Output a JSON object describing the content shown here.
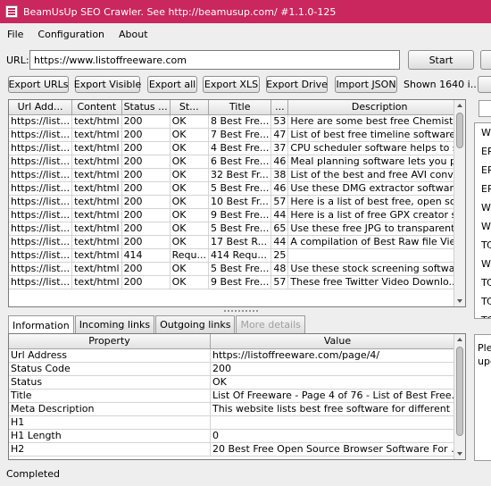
{
  "window": {
    "title": "BeamUsUp SEO Crawler. See http://beamusup.com/ #1.1.0-125"
  },
  "menu": {
    "items": [
      "File",
      "Configuration",
      "About"
    ]
  },
  "url_bar": {
    "label": "URL:",
    "value": "https://www.listoffreeware.com",
    "start_label": "Start"
  },
  "exports": {
    "buttons": [
      "Export URLs",
      "Export Visible",
      "Export all",
      "Export XLS",
      "Export Drive",
      "Import JSON"
    ],
    "shown_text": "Shown 1640 i..."
  },
  "url_table": {
    "columns": [
      "Url Add...",
      "Content",
      "Status ...",
      "St...",
      "Title",
      "...",
      "Description"
    ],
    "rows": [
      [
        "https://list...",
        "text/html",
        "200",
        "OK",
        "8 Best Fre...",
        "53",
        "Here are some best free Chemistr..."
      ],
      [
        "https://list...",
        "text/html",
        "200",
        "OK",
        "7 Best Fre...",
        "47",
        "List of best free timeline software ..."
      ],
      [
        "https://list...",
        "text/html",
        "200",
        "OK",
        "4 Best Fre...",
        "37",
        "CPU scheduler software helps to s..."
      ],
      [
        "https://list...",
        "text/html",
        "200",
        "OK",
        "6 Best Fre...",
        "46",
        "Meal planning software lets you pl..."
      ],
      [
        "https://list...",
        "text/html",
        "200",
        "OK",
        "32 Best Fr...",
        "38",
        "List of the best and free AVI conv..."
      ],
      [
        "https://list...",
        "text/html",
        "200",
        "OK",
        "5 Best Fre...",
        "46",
        "Use these DMG extractor software..."
      ],
      [
        "https://list...",
        "text/html",
        "200",
        "OK",
        "10 Best Fr...",
        "57",
        "Here is a list of best free, open so..."
      ],
      [
        "https://list...",
        "text/html",
        "200",
        "OK",
        "9 Best Fre...",
        "44",
        "Here is a list of free GPX creator s..."
      ],
      [
        "https://list...",
        "text/html",
        "200",
        "OK",
        "5 Best Fre...",
        "65",
        "Use these free JPG to transparent..."
      ],
      [
        "https://list...",
        "text/html",
        "200",
        "OK",
        "17 Best R...",
        "44",
        "A compilation of Best Raw file Vie..."
      ],
      [
        "https://list...",
        "text/html",
        "414",
        "Requ...",
        "414 Requ...",
        "25",
        ""
      ],
      [
        "https://list...",
        "text/html",
        "200",
        "OK",
        "5 Best Fre...",
        "48",
        "Use these stock screening softwar..."
      ],
      [
        "https://list...",
        "text/html",
        "200",
        "OK",
        "9 Best Fre...",
        "57",
        "These free Twitter Video Downlo..."
      ]
    ]
  },
  "detail_tabs": {
    "tabs": [
      "Information",
      "Incoming links",
      "Outgoing links",
      "More details"
    ]
  },
  "info_table": {
    "columns": [
      "Property",
      "Value"
    ],
    "rows": [
      [
        "Url Address",
        "https://listoffreeware.com/page/4/"
      ],
      [
        "Status Code",
        "200"
      ],
      [
        "Status",
        "OK"
      ],
      [
        "Title",
        "List Of Freeware - Page 4 of 76 - List of Best Free..."
      ],
      [
        "Meta Description",
        "This website lists best free software for different ..."
      ],
      [
        "H1",
        ""
      ],
      [
        "H1 Length",
        "0"
      ],
      [
        "H2",
        "20 Best Free Open Source Browser Software For ..."
      ]
    ]
  },
  "right_panel": {
    "items": [
      "W",
      "ER",
      "ER",
      "ER",
      "W",
      "W",
      "TC",
      "W",
      "TC",
      "TC",
      "TC"
    ]
  },
  "right_text": {
    "line1": "Ple",
    "line2": "upo"
  },
  "status": {
    "text": "Completed"
  }
}
